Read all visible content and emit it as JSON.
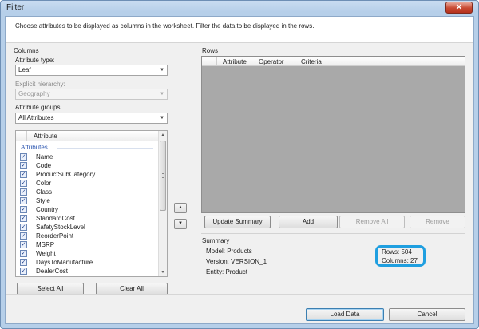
{
  "window": {
    "title": "Filter",
    "close_glyph": "✕"
  },
  "instruction": "Choose attributes to be displayed as columns in the worksheet. Filter the data to be displayed in the rows.",
  "columns": {
    "section_label": "Columns",
    "attribute_type": {
      "label": "Attribute type:",
      "value": "Leaf"
    },
    "explicit_hierarchy": {
      "label": "Explicit hierarchy:",
      "value": "Geography"
    },
    "attribute_groups": {
      "label": "Attribute groups:",
      "value": "All Attributes"
    },
    "list": {
      "header": "Attribute",
      "group": "Attributes",
      "items": [
        {
          "label": "Name",
          "checked": true
        },
        {
          "label": "Code",
          "checked": true
        },
        {
          "label": "ProductSubCategory",
          "checked": true
        },
        {
          "label": "Color",
          "checked": true
        },
        {
          "label": "Class",
          "checked": true
        },
        {
          "label": "Style",
          "checked": true
        },
        {
          "label": "Country",
          "checked": true
        },
        {
          "label": "StandardCost",
          "checked": true
        },
        {
          "label": "SafetyStockLevel",
          "checked": true
        },
        {
          "label": "ReorderPoint",
          "checked": true
        },
        {
          "label": "MSRP",
          "checked": true
        },
        {
          "label": "Weight",
          "checked": true
        },
        {
          "label": "DaysToManufacture",
          "checked": true
        },
        {
          "label": "DealerCost",
          "checked": true
        }
      ],
      "check_glyph": "✓"
    },
    "select_all": "Select All",
    "clear_all": "Clear All",
    "move_up_glyph": "▲",
    "move_down_glyph": "▼"
  },
  "rows": {
    "section_label": "Rows",
    "headers": [
      "Attribute",
      "Operator",
      "Criteria"
    ],
    "update_summary": "Update Summary",
    "add": "Add",
    "remove_all": "Remove All",
    "remove": "Remove"
  },
  "summary": {
    "section_label": "Summary",
    "model": "Model: Products",
    "version": "Version: VERSION_1",
    "entity": "Entity: Product",
    "rows": "Rows: 504",
    "columns": "Columns: 27"
  },
  "footer": {
    "load_data": "Load Data",
    "cancel": "Cancel"
  },
  "colors": {
    "highlight": "#1f9fe0",
    "grid_background": "#a9a9a9",
    "group_title": "#2b55b0"
  }
}
